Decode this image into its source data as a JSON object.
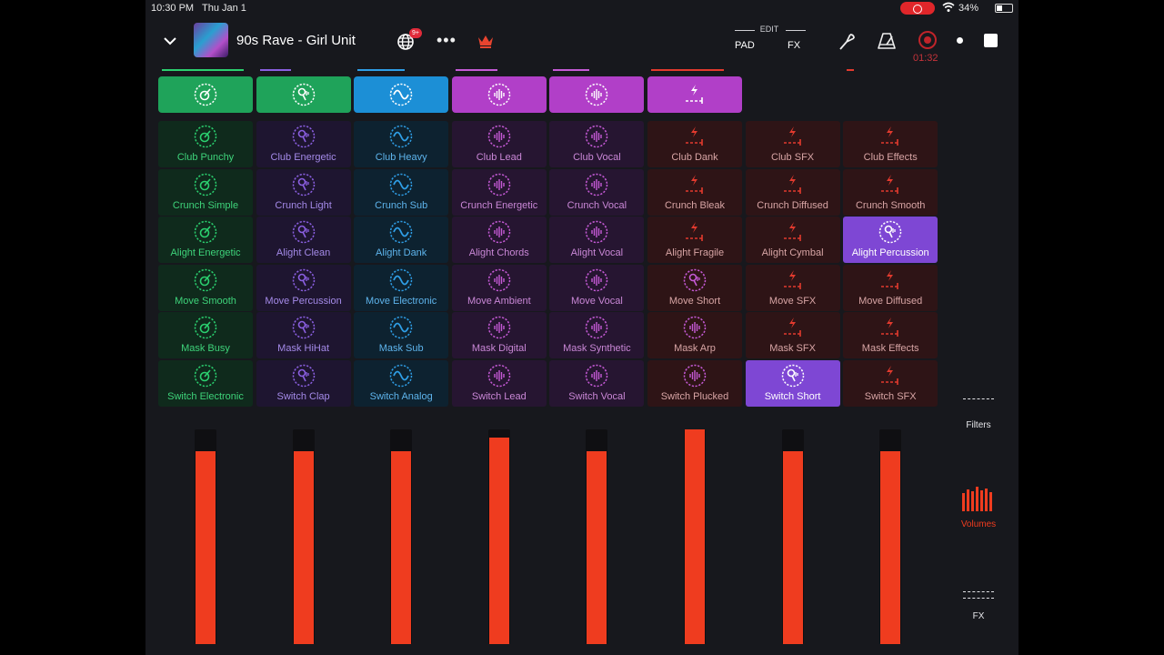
{
  "status_bar": {
    "time": "10:30 PM",
    "date": "Thu Jan 1",
    "battery": "34%"
  },
  "header": {
    "song_title": "90s Rave - Girl Unit",
    "notification_badge": "9+",
    "edit_label": "EDIT",
    "pad_label": "PAD",
    "fx_label": "FX",
    "record_time": "01:32"
  },
  "colors": {
    "green": "#1fa35a",
    "blue": "#1c8fd6",
    "magenta": "#b13fc8",
    "red": "#e23a2e",
    "active_purple": "#7e47d4",
    "fader": "#ef3c1f"
  },
  "columns": [
    {
      "icon": "drum-icon",
      "accent": "#2bd06f",
      "pad_bg": "#0f2a1c",
      "label_color": "#3ed37a",
      "top_bg": "#1fa35a"
    },
    {
      "icon": "voice-icon",
      "accent": "#8a5fe0",
      "pad_bg": "#1e1530",
      "label_color": "#a48ae8",
      "top_bg": "#1fa35a"
    },
    {
      "icon": "wave-icon",
      "accent": "#2f9ee6",
      "pad_bg": "#0d2230",
      "label_color": "#5eb4ec",
      "top_bg": "#1c8fd6"
    },
    {
      "icon": "sample-icon",
      "accent": "#c55ad6",
      "pad_bg": "#261531",
      "label_color": "#c987d6",
      "top_bg": "#b13fc8"
    },
    {
      "icon": "sample-icon",
      "accent": "#c55ad6",
      "pad_bg": "#261531",
      "label_color": "#c987d6",
      "top_bg": "#b13fc8"
    },
    {
      "icon": "fx-icon",
      "accent": "#e23a2e",
      "pad_bg": "#2e1416",
      "label_color": "#d8a5a5",
      "top_bg": "#b13fc8"
    },
    {
      "icon": "fx-icon",
      "accent": "#e23a2e",
      "pad_bg": "#2e1416",
      "label_color": "#d8a5a5",
      "top_bg": null
    },
    {
      "icon": "fx-icon",
      "accent": "#e23a2e",
      "pad_bg": "#2e1416",
      "label_color": "#d8a5a5",
      "top_bg": null
    }
  ],
  "pads": [
    [
      "Club Punchy",
      "Club Energetic",
      "Club Heavy",
      "Club Lead",
      "Club Vocal",
      "Club Dank",
      "Club SFX",
      "Club Effects"
    ],
    [
      "Crunch Simple",
      "Crunch Light",
      "Crunch Sub",
      "Crunch Energetic",
      "Crunch Vocal",
      "Crunch Bleak",
      "Crunch Diffused",
      "Crunch Smooth"
    ],
    [
      "Alight Energetic",
      "Alight Clean",
      "Alight Dank",
      "Alight Chords",
      "Alight Vocal",
      "Alight Fragile",
      "Alight Cymbal",
      "Alight Percussion"
    ],
    [
      "Move Smooth",
      "Move Percussion",
      "Move Electronic",
      "Move Ambient",
      "Move Vocal",
      "Move Short",
      "Move SFX",
      "Move Diffused"
    ],
    [
      "Mask Busy",
      "Mask HiHat",
      "Mask Sub",
      "Mask Digital",
      "Mask Synthetic",
      "Mask Arp",
      "Mask SFX",
      "Mask Effects"
    ],
    [
      "Switch Electronic",
      "Switch Clap",
      "Switch Analog",
      "Switch Lead",
      "Switch Vocal",
      "Switch Plucked",
      "Switch Short",
      "Switch SFX"
    ]
  ],
  "pad_icon_overrides": [
    {
      "row": 3,
      "col": 5,
      "icon": "voice-icon"
    },
    {
      "row": 4,
      "col": 5,
      "icon": "sample-icon"
    },
    {
      "row": 5,
      "col": 5,
      "icon": "sample-icon"
    },
    {
      "row": 2,
      "col": 7,
      "icon": "voice-icon"
    },
    {
      "row": 5,
      "col": 6,
      "icon": "voice-icon"
    }
  ],
  "active_pads": [
    {
      "row": 2,
      "col": 7
    },
    {
      "row": 5,
      "col": 6
    }
  ],
  "fader_levels": [
    0.9,
    0.9,
    0.9,
    0.96,
    0.9,
    1.0,
    0.9,
    0.9
  ],
  "side_panel": {
    "filters_label": "Filters",
    "volumes_label": "Volumes",
    "fx_label": "FX"
  }
}
